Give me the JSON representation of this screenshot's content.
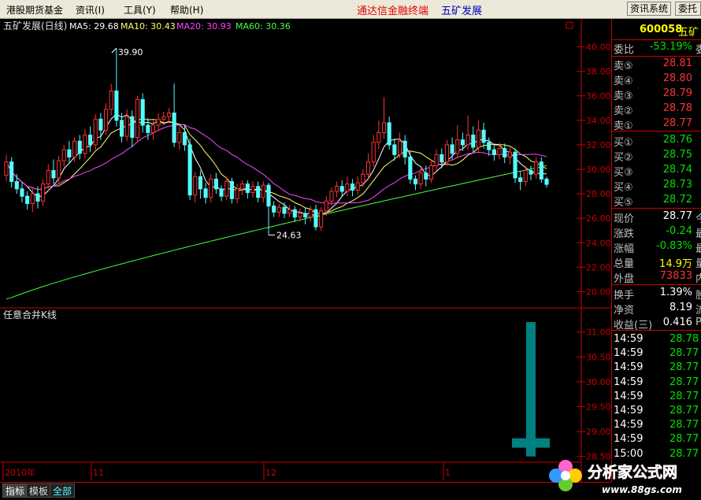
{
  "menu": {
    "items": [
      "港股期货基金",
      "资讯(I)",
      "工具(Y)",
      "帮助(H)"
    ],
    "app_title": "通达信金融终端",
    "stock_title": "五矿发展",
    "info_button": "资讯系统",
    "delegate_button": "委托"
  },
  "chart": {
    "main_label": "五矿发展(日线)",
    "ma": [
      {
        "label": "MA5: 29.68",
        "color": "#ffffff"
      },
      {
        "label": "MA10: 30.43",
        "color": "#ffff66"
      },
      {
        "label": "MA20: 30.93",
        "color": "#ff44ff"
      },
      {
        "label": "MA60: 30.36",
        "color": "#44ff44"
      }
    ],
    "y_ticks": [
      "40.00",
      "38.00",
      "36.00",
      "34.00",
      "32.00",
      "30.00",
      "28.00",
      "26.00",
      "24.00",
      "22.00",
      "20.00"
    ],
    "high_marker": "39.90",
    "low_marker": "24.63",
    "sub_label": "任意合并K线",
    "sub_ticks": [
      "31.00",
      "30.50",
      "30.00",
      "29.50",
      "29.00",
      "28.50"
    ],
    "x_labels": [
      "2010年",
      "11",
      "12",
      "1"
    ],
    "colors": {
      "up": "#ff3232",
      "down": "#54fcfc",
      "axis": "#c80000",
      "sub_bar": "#008080"
    }
  },
  "chart_data": [
    {
      "type": "candlestick",
      "title": "五矿发展(日线)",
      "ylim": [
        19,
        41
      ],
      "series_ma": [
        "MA5: 29.68",
        "MA10: 30.43",
        "MA20: 30.93",
        "MA60: 30.36"
      ],
      "annotations": [
        "39.90",
        "24.63"
      ],
      "candles": [
        [
          29.5,
          30.6,
          31.2,
          29.0
        ],
        [
          30.6,
          29.0,
          31.0,
          28.5
        ],
        [
          29.0,
          28.4,
          29.6,
          28.0
        ],
        [
          28.4,
          27.8,
          28.9,
          27.3
        ],
        [
          27.8,
          27.2,
          28.2,
          26.7
        ],
        [
          27.2,
          28.0,
          28.5,
          26.5
        ],
        [
          28.0,
          27.4,
          28.6,
          26.8
        ],
        [
          27.4,
          28.8,
          29.2,
          27.0
        ],
        [
          28.8,
          29.9,
          30.4,
          28.4
        ],
        [
          29.9,
          29.3,
          30.8,
          28.8
        ],
        [
          29.3,
          30.7,
          31.1,
          28.9
        ],
        [
          30.7,
          31.6,
          32.0,
          30.2
        ],
        [
          31.6,
          31.0,
          32.3,
          30.5
        ],
        [
          31.0,
          32.3,
          32.6,
          30.6
        ],
        [
          32.3,
          31.3,
          32.8,
          30.8
        ],
        [
          31.3,
          32.8,
          33.3,
          30.9
        ],
        [
          32.8,
          32.0,
          33.5,
          31.4
        ],
        [
          32.0,
          34.1,
          34.5,
          31.6
        ],
        [
          34.1,
          33.2,
          34.6,
          32.4
        ],
        [
          33.2,
          34.9,
          35.4,
          32.8
        ],
        [
          34.9,
          36.4,
          37.0,
          34.4
        ],
        [
          36.4,
          34.0,
          39.9,
          33.5
        ],
        [
          34.0,
          32.7,
          34.6,
          32.2
        ],
        [
          32.7,
          34.3,
          34.9,
          32.3
        ],
        [
          34.3,
          32.6,
          34.8,
          31.8
        ],
        [
          32.6,
          35.7,
          36.0,
          32.3
        ],
        [
          35.7,
          33.6,
          36.2,
          33.0
        ],
        [
          33.6,
          33.0,
          34.2,
          32.4
        ],
        [
          33.0,
          33.6,
          34.0,
          32.4
        ],
        [
          33.6,
          34.1,
          34.6,
          33.1
        ],
        [
          34.1,
          34.3,
          34.7,
          33.6
        ],
        [
          34.3,
          34.6,
          35.0,
          33.8
        ],
        [
          34.6,
          32.2,
          37.0,
          31.8
        ],
        [
          32.2,
          33.0,
          33.5,
          31.6
        ],
        [
          33.0,
          32.0,
          33.6,
          31.5
        ],
        [
          32.0,
          27.9,
          32.5,
          27.5
        ],
        [
          27.9,
          29.4,
          29.8,
          27.3
        ],
        [
          29.4,
          28.4,
          29.9,
          27.6
        ],
        [
          28.4,
          27.7,
          28.9,
          27.2
        ],
        [
          27.7,
          29.2,
          29.6,
          27.3
        ],
        [
          29.2,
          28.4,
          29.7,
          28.0
        ],
        [
          28.4,
          27.8,
          28.7,
          27.4
        ],
        [
          27.8,
          29.0,
          29.4,
          27.5
        ],
        [
          29.0,
          27.6,
          29.3,
          27.2
        ],
        [
          27.6,
          28.4,
          28.8,
          27.2
        ],
        [
          28.4,
          28.8,
          29.1,
          27.9
        ],
        [
          28.8,
          28.1,
          29.1,
          27.6
        ],
        [
          28.1,
          28.6,
          29.0,
          27.7
        ],
        [
          28.6,
          27.7,
          29.0,
          27.3
        ],
        [
          27.7,
          28.7,
          29.0,
          27.3
        ],
        [
          28.7,
          27.0,
          28.9,
          24.63
        ],
        [
          27.0,
          26.5,
          27.4,
          26.1
        ],
        [
          26.5,
          26.9,
          27.2,
          26.1
        ],
        [
          26.9,
          26.4,
          27.3,
          26.0
        ],
        [
          26.4,
          26.7,
          27.1,
          26.1
        ],
        [
          26.7,
          26.1,
          27.0,
          25.7
        ],
        [
          26.1,
          26.4,
          26.8,
          25.7
        ],
        [
          26.4,
          26.1,
          26.9,
          25.5
        ],
        [
          26.1,
          26.7,
          27.0,
          25.7
        ],
        [
          26.7,
          25.3,
          27.1,
          25.0
        ],
        [
          25.3,
          26.6,
          26.9,
          25.0
        ],
        [
          26.6,
          27.4,
          27.8,
          26.2
        ],
        [
          27.4,
          28.2,
          28.5,
          27.0
        ],
        [
          28.2,
          28.6,
          29.0,
          27.7
        ],
        [
          28.6,
          28.2,
          29.1,
          27.8
        ],
        [
          28.2,
          28.8,
          29.4,
          27.8
        ],
        [
          28.8,
          28.3,
          29.2,
          27.8
        ],
        [
          28.3,
          28.9,
          29.4,
          27.9
        ],
        [
          28.9,
          29.6,
          30.0,
          28.5
        ],
        [
          29.6,
          30.6,
          31.3,
          29.1
        ],
        [
          30.6,
          32.2,
          32.8,
          30.2
        ],
        [
          32.2,
          33.0,
          34.0,
          31.6
        ],
        [
          33.0,
          33.8,
          35.9,
          32.5
        ],
        [
          33.8,
          32.0,
          34.3,
          31.6
        ],
        [
          32.0,
          31.2,
          32.5,
          30.7
        ],
        [
          31.2,
          32.3,
          33.0,
          30.9
        ],
        [
          32.3,
          31.0,
          32.8,
          30.4
        ],
        [
          31.0,
          29.2,
          31.5,
          28.8
        ],
        [
          29.2,
          28.8,
          29.5,
          28.3
        ],
        [
          28.8,
          29.7,
          30.1,
          28.4
        ],
        [
          29.7,
          29.2,
          30.3,
          28.6
        ],
        [
          29.2,
          30.3,
          30.8,
          28.9
        ],
        [
          30.3,
          31.2,
          31.6,
          29.9
        ],
        [
          31.2,
          30.6,
          31.7,
          30.1
        ],
        [
          30.6,
          32.0,
          32.4,
          30.3
        ],
        [
          32.0,
          31.3,
          32.6,
          30.8
        ],
        [
          31.3,
          32.4,
          33.6,
          30.9
        ],
        [
          32.4,
          32.0,
          33.0,
          31.5
        ],
        [
          32.0,
          32.8,
          34.4,
          31.6
        ],
        [
          32.8,
          31.8,
          33.5,
          31.4
        ],
        [
          31.8,
          33.2,
          34.0,
          31.4
        ],
        [
          33.2,
          32.2,
          33.8,
          31.7
        ],
        [
          32.2,
          31.6,
          32.6,
          31.1
        ],
        [
          31.6,
          31.2,
          32.0,
          30.7
        ],
        [
          31.2,
          31.7,
          32.2,
          30.8
        ],
        [
          31.7,
          31.0,
          32.1,
          30.5
        ],
        [
          31.0,
          31.4,
          31.8,
          30.4
        ],
        [
          31.4,
          29.3,
          31.7,
          28.9
        ],
        [
          29.3,
          29.0,
          29.8,
          28.3
        ],
        [
          29.0,
          29.9,
          30.3,
          28.6
        ],
        [
          29.9,
          29.6,
          30.3,
          29.1
        ],
        [
          29.6,
          30.6,
          31.0,
          29.2
        ],
        [
          30.6,
          29.2,
          31.0,
          28.9
        ],
        [
          29.2,
          28.77,
          29.4,
          28.5
        ]
      ],
      "ma_last": {
        "MA5": 29.68,
        "MA10": 30.43,
        "MA20": 30.93,
        "MA60": 30.36
      }
    },
    {
      "type": "candlestick",
      "title": "任意合并K线",
      "ylim": [
        28.4,
        31.2
      ],
      "candles": [
        [
          31.2,
          28.77,
          31.2,
          28.5
        ]
      ]
    }
  ],
  "quote": {
    "code": "600058",
    "name_part": "五矿",
    "weibi_label": "委比",
    "weibi_value": "-53.19%",
    "weibi_tail": "委",
    "asks": [
      {
        "label": "卖⑤",
        "price": "28.81"
      },
      {
        "label": "卖④",
        "price": "28.80"
      },
      {
        "label": "卖③",
        "price": "28.79"
      },
      {
        "label": "卖②",
        "price": "28.78"
      },
      {
        "label": "卖①",
        "price": "28.77"
      }
    ],
    "bids": [
      {
        "label": "买①",
        "price": "28.76"
      },
      {
        "label": "买②",
        "price": "28.75"
      },
      {
        "label": "买③",
        "price": "28.74"
      },
      {
        "label": "买④",
        "price": "28.73"
      },
      {
        "label": "买⑤",
        "price": "28.72"
      }
    ],
    "stats": [
      {
        "label": "现价",
        "value": "28.77",
        "tail": "今",
        "color": "#ffffff"
      },
      {
        "label": "涨跌",
        "value": "-0.24",
        "tail": "最",
        "color": "#00e000"
      },
      {
        "label": "涨幅",
        "value": "-0.83%",
        "tail": "最",
        "color": "#00e000"
      },
      {
        "label": "总量",
        "value": "14.9万",
        "tail": "量",
        "color": "#ffff00"
      },
      {
        "label": "外盘",
        "value": "73833",
        "tail": "内",
        "color": "#ff3232"
      }
    ],
    "fin": [
      {
        "label": "换手",
        "value": "1.39%",
        "tail": "股"
      },
      {
        "label": "净资",
        "value": "8.19",
        "tail": "流"
      },
      {
        "label": "收益(三)",
        "value": "0.416",
        "tail": "P"
      }
    ],
    "ticks": [
      {
        "time": "14:59",
        "price": "28.78"
      },
      {
        "time": "14:59",
        "price": "28.77"
      },
      {
        "time": "14:59",
        "price": "28.77"
      },
      {
        "time": "14:59",
        "price": "28.77"
      },
      {
        "time": "14:59",
        "price": "28.77"
      },
      {
        "time": "14:59",
        "price": "28.77"
      },
      {
        "time": "14:59",
        "price": "28.77"
      },
      {
        "time": "14:59",
        "price": "28.77"
      },
      {
        "time": "15:00",
        "price": "28.77"
      }
    ]
  },
  "bottom": {
    "tabs": [
      "指标",
      "模板",
      "全部"
    ]
  },
  "watermark": {
    "site": "分析家公式网",
    "url": "www.88gs.com"
  }
}
